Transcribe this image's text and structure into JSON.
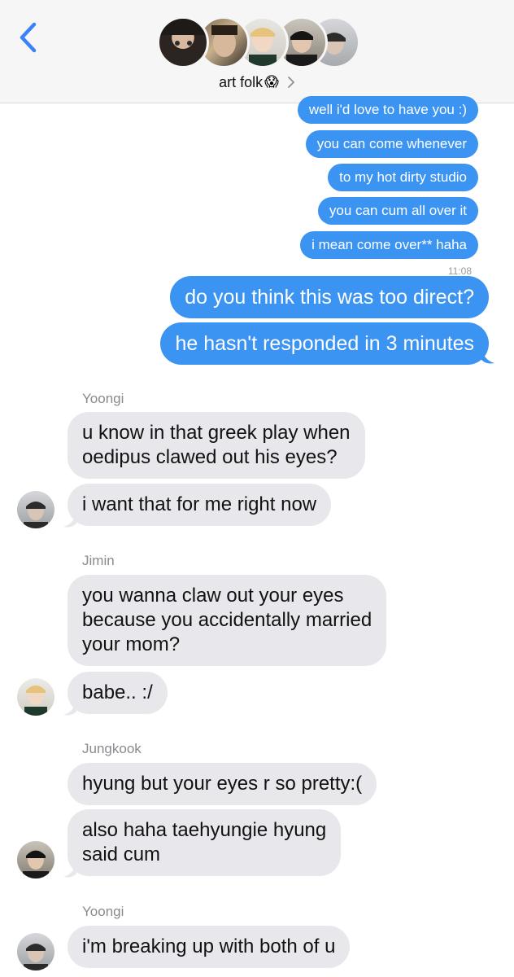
{
  "header": {
    "group_name": "art folk",
    "group_emoji": "😱",
    "back_icon": "chevron-left-icon",
    "details_icon": "chevron-right-icon",
    "accent_color": "#3b93f2"
  },
  "outgoing_small": [
    "well i'd love to have you :)",
    "you can come whenever",
    "to my hot dirty studio",
    "you can cum all over it",
    "i mean come over** haha"
  ],
  "timestamp": "11:08",
  "outgoing_large": [
    "do you think this was too direct?",
    "he hasn't responded in 3 minutes"
  ],
  "groups": [
    {
      "sender": "Yoongi",
      "messages": [
        [
          "u know in that greek play when",
          "oedipus clawed out his eyes?"
        ],
        [
          "i want that for me right now"
        ]
      ]
    },
    {
      "sender": "Jimin",
      "messages": [
        [
          "you wanna claw out your eyes",
          "because you accidentally married",
          "your mom?"
        ],
        [
          "babe.. :/"
        ]
      ]
    },
    {
      "sender": "Jungkook",
      "messages": [
        [
          "hyung but your eyes r so pretty:("
        ],
        [
          "also haha taehyungie hyung",
          "said cum"
        ]
      ]
    },
    {
      "sender": "Yoongi",
      "messages": [
        [
          "i'm breaking up with both of u"
        ]
      ]
    }
  ],
  "colors": {
    "outgoing_bubble": "#3b93f2",
    "incoming_bubble": "#e8e8ec",
    "header_bg": "#f6f6f7",
    "sender_text": "#8a8a8f"
  }
}
